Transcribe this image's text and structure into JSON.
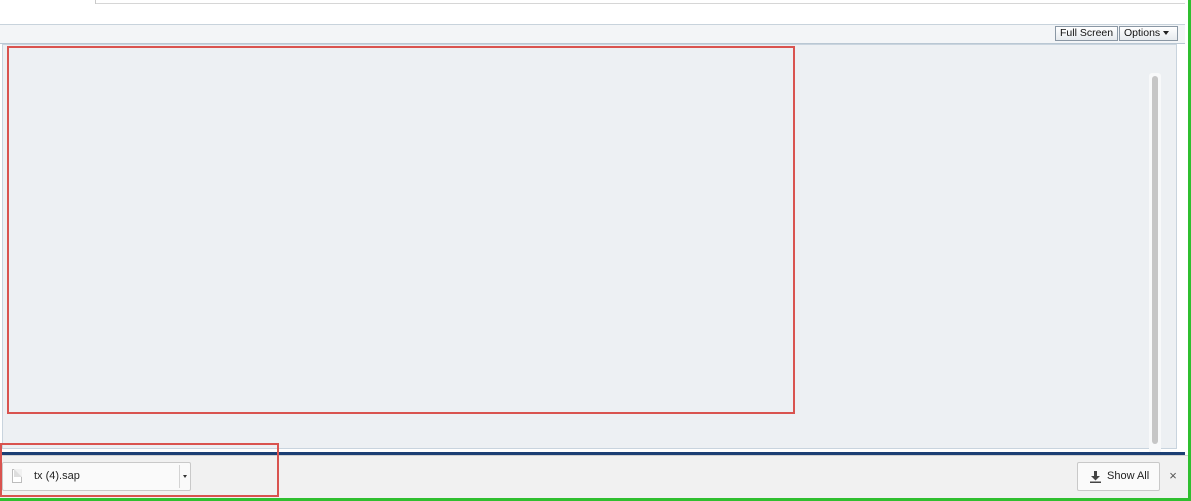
{
  "toolbar": {
    "full_screen_label": "Full Screen",
    "options_label": "Options"
  },
  "downloads": {
    "items": [
      {
        "file_name": "tx (4).sap",
        "icon": "file-icon"
      }
    ],
    "show_all_label": "Show All",
    "show_all_icon": "download-icon",
    "close_label": "×"
  },
  "colors": {
    "highlight": "#d9534f",
    "frame_green": "#2fbf2f",
    "frame_blue": "#1c3f74",
    "viewer_background": "#edf0f3"
  }
}
